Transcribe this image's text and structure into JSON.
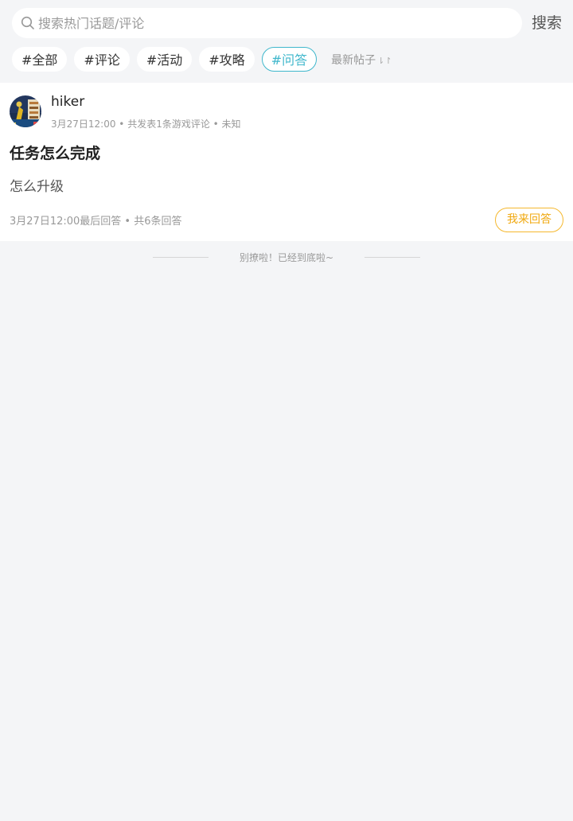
{
  "search": {
    "placeholder": "搜索热门话题/评论",
    "value": "",
    "button_label": "搜索"
  },
  "tags": [
    {
      "label": "#全部",
      "active": false
    },
    {
      "label": "#评论",
      "active": false
    },
    {
      "label": "#活动",
      "active": false
    },
    {
      "label": "#攻略",
      "active": false
    },
    {
      "label": "#问答",
      "active": true
    }
  ],
  "sort": {
    "label": "最新帖子",
    "icon": "sort-arrows-icon",
    "glyph": "⇂↾"
  },
  "post": {
    "username": "hiker",
    "meta": "3月27日12:00 • 共发表1条游戏评论 • 未知",
    "title": "任务怎么完成",
    "body": "怎么升级",
    "footer": "3月27日12:00最后回答 • 共6条回答",
    "answer_button_label": "我来回答"
  },
  "end_message": "别撩啦！已经到底啦~",
  "colors": {
    "background": "#f4f5f7",
    "accent_teal": "#3fb7cc",
    "accent_orange": "#f0a80f"
  }
}
